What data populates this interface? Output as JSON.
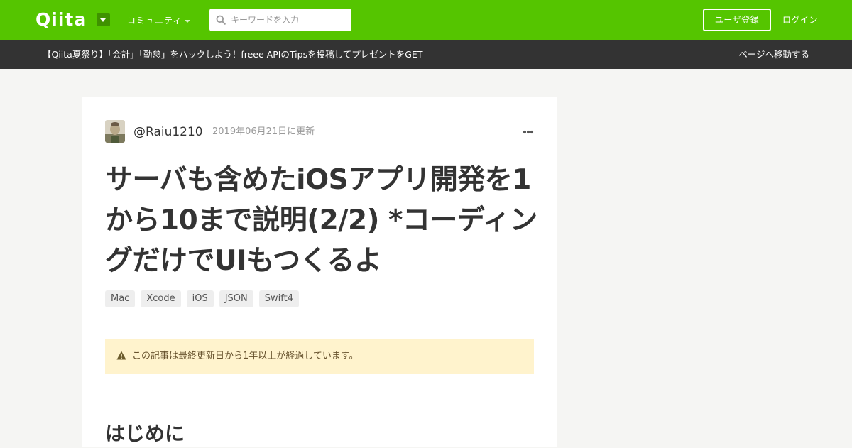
{
  "header": {
    "logo_text": "Qiita",
    "community_label": "コミュニティ",
    "search": {
      "placeholder": "キーワードを入力",
      "value": ""
    },
    "signup_label": "ユーザ登録",
    "login_label": "ログイン",
    "colors": {
      "brand": "#55c500",
      "brand_dark": "#3f9200"
    }
  },
  "banner": {
    "text": "【Qiita夏祭り】「会計」「勤怠」をハックしよう！freee APIのTipsを投稿してプレゼントをGET",
    "link_label": "ページへ移動する"
  },
  "article": {
    "author": "@Raiu1210",
    "updated": "2019年06月21日に更新",
    "title": "サーバも含めたiOSアプリ開発を1から10まで説明(2/2) *コーディングだけでUIもつくるよ",
    "tags": [
      {
        "label": "Mac"
      },
      {
        "label": "Xcode"
      },
      {
        "label": "iOS"
      },
      {
        "label": "JSON"
      },
      {
        "label": "Swift4"
      }
    ],
    "notice": "この記事は最終更新日から1年以上が経過しています。",
    "first_heading": "はじめに",
    "icons": {
      "more": "more-horizontal-icon",
      "warning": "warning-triangle-icon",
      "search": "search-icon"
    }
  }
}
